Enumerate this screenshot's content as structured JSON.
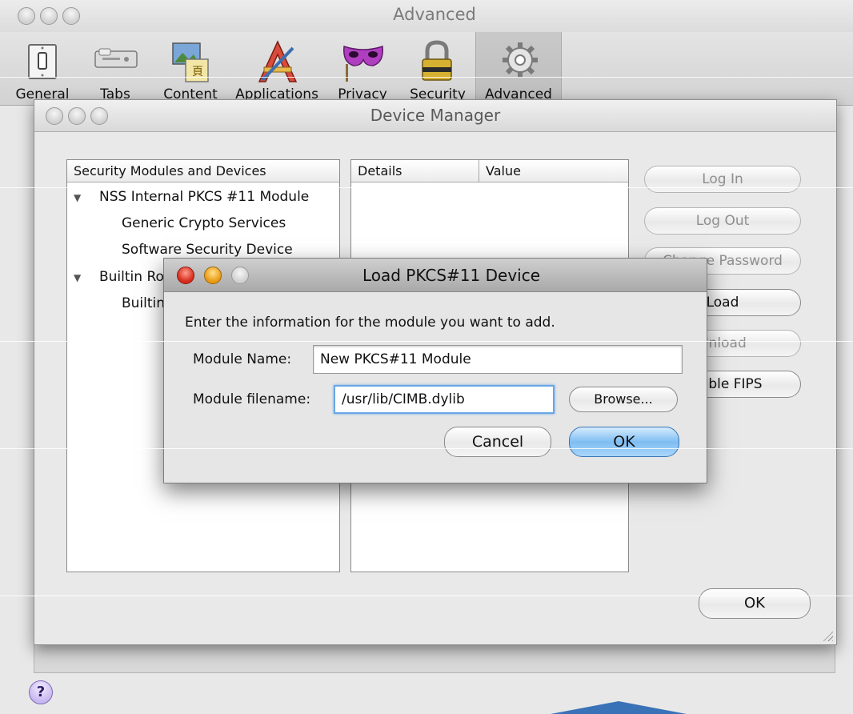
{
  "prefs": {
    "title": "Advanced",
    "toolbar": [
      {
        "key": "general",
        "label": "General",
        "icon": "light-switch-icon"
      },
      {
        "key": "tabs",
        "label": "Tabs",
        "icon": "tab-bar-icon"
      },
      {
        "key": "content",
        "label": "Content",
        "icon": "content-picture-icon"
      },
      {
        "key": "applications",
        "label": "Applications",
        "icon": "applications-pencil-icon"
      },
      {
        "key": "privacy",
        "label": "Privacy",
        "icon": "privacy-mask-icon"
      },
      {
        "key": "security",
        "label": "Security",
        "icon": "padlock-icon"
      },
      {
        "key": "advanced",
        "label": "Advanced",
        "icon": "gear-icon",
        "selected": true
      }
    ],
    "help_label": "?"
  },
  "device_manager": {
    "title": "Device Manager",
    "columns": {
      "modules": "Security Modules and Devices",
      "details": "Details",
      "value": "Value"
    },
    "tree": [
      {
        "label": "NSS Internal PKCS #11 Module",
        "level": 0,
        "expanded": true
      },
      {
        "label": "Generic Crypto Services",
        "level": 1
      },
      {
        "label": "Software Security Device",
        "level": 1
      },
      {
        "label": "Builtin Ro",
        "level": 0,
        "expanded": true
      },
      {
        "label": "Builtin",
        "level": 1
      }
    ],
    "buttons": {
      "log_in": "Log In",
      "log_out": "Log Out",
      "change_password": "Change Password",
      "load": "Load",
      "unload": "Unload",
      "enable_fips": "Enable FIPS",
      "ok": "OK"
    }
  },
  "load_dialog": {
    "title": "Load PKCS#11 Device",
    "prompt": "Enter the information for the module you want to add.",
    "module_name_label": "Module Name:",
    "module_name_value": "New PKCS#11 Module",
    "module_filename_label": "Module filename:",
    "module_filename_value": "/usr/lib/CIMB.dylib",
    "browse_label": "Browse...",
    "cancel_label": "Cancel",
    "ok_label": "OK"
  }
}
